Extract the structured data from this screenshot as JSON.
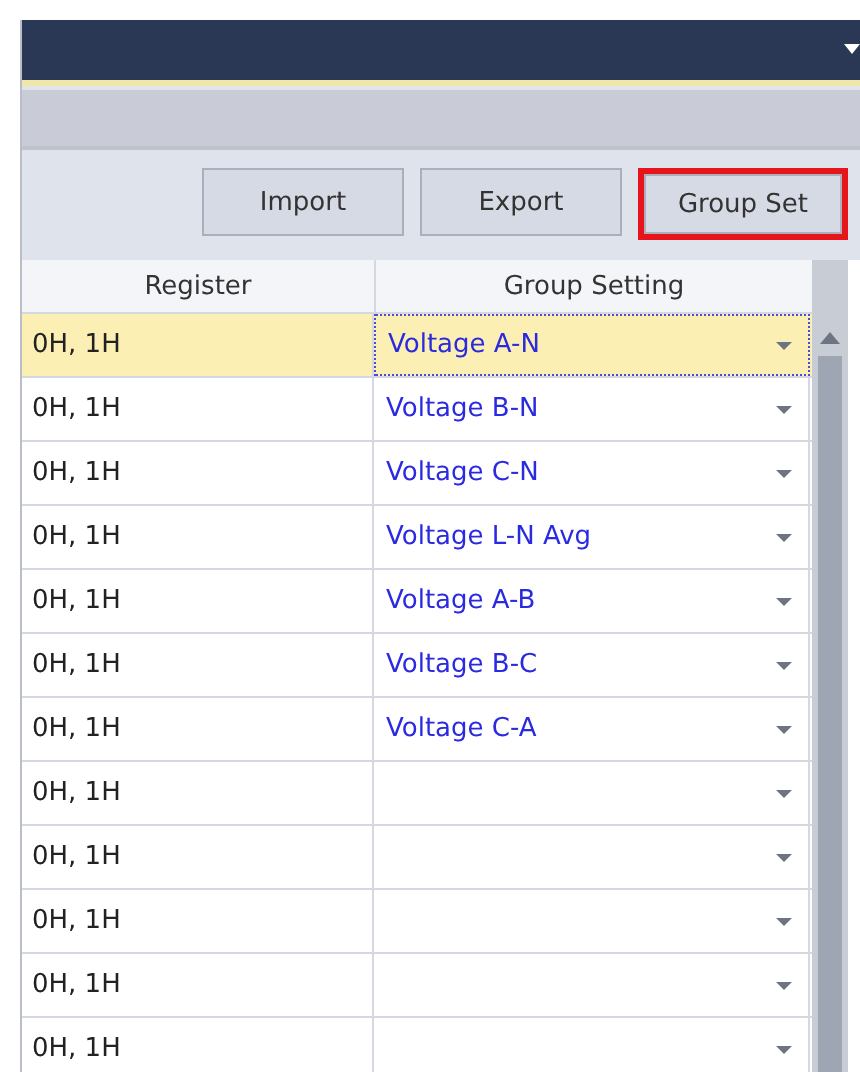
{
  "toolbar": {
    "buttons": [
      {
        "label": "Import",
        "highlighted": false
      },
      {
        "label": "Export",
        "highlighted": false
      },
      {
        "label": "Group Set",
        "highlighted": true
      }
    ]
  },
  "table": {
    "columns": [
      "Register",
      "Group Setting"
    ],
    "rows": [
      {
        "register": "0H, 1H",
        "group": "Voltage A-N",
        "selected": true
      },
      {
        "register": "0H, 1H",
        "group": "Voltage B-N",
        "selected": false
      },
      {
        "register": "0H, 1H",
        "group": "Voltage C-N",
        "selected": false
      },
      {
        "register": "0H, 1H",
        "group": "Voltage L-N Avg",
        "selected": false
      },
      {
        "register": "0H, 1H",
        "group": "Voltage A-B",
        "selected": false
      },
      {
        "register": "0H, 1H",
        "group": "Voltage B-C",
        "selected": false
      },
      {
        "register": "0H, 1H",
        "group": "Voltage C-A",
        "selected": false
      },
      {
        "register": "0H, 1H",
        "selected": false
      },
      {
        "register": "0H, 1H",
        "selected": false
      },
      {
        "register": "0H, 1H",
        "selected": false
      },
      {
        "register": "0H, 1H",
        "selected": false
      },
      {
        "register": "0H, 1H",
        "selected": false
      }
    ]
  }
}
